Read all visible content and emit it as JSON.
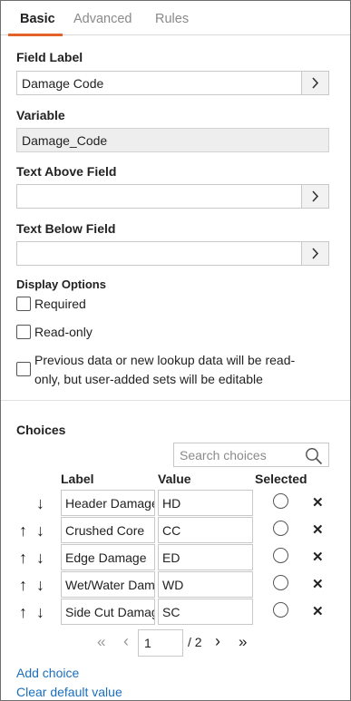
{
  "tabs": {
    "basic": "Basic",
    "advanced": "Advanced",
    "rules": "Rules"
  },
  "field_label": {
    "label": "Field Label",
    "value": "Damage Code"
  },
  "variable": {
    "label": "Variable",
    "value": "Damage_Code"
  },
  "text_above": {
    "label": "Text Above Field",
    "value": ""
  },
  "text_below": {
    "label": "Text Below Field",
    "value": ""
  },
  "display_options": {
    "label": "Display Options",
    "required": "Required",
    "readonly": "Read-only",
    "previous_line1": "Previous data or new lookup data will be read-",
    "previous_line2": "only, but user-added sets will be editable"
  },
  "choices": {
    "title": "Choices",
    "search_placeholder": "Search choices",
    "col_label": "Label",
    "col_value": "Value",
    "col_selected": "Selected",
    "rows": [
      {
        "label": "Header Damage",
        "value": "HD"
      },
      {
        "label": "Crushed Core",
        "value": "CC"
      },
      {
        "label": "Edge Damage",
        "value": "ED"
      },
      {
        "label": "Wet/Water Damage",
        "value": "WD"
      },
      {
        "label": "Side Cut Damage",
        "value": "SC"
      }
    ],
    "up_arrow": "↑",
    "down_arrow": "↓",
    "delete_glyph": "✕"
  },
  "pagination": {
    "first": "«",
    "prev": "‹",
    "page": "1",
    "total": "/ 2",
    "next": "›",
    "last": "»"
  },
  "links": {
    "add_choice": "Add choice",
    "clear_default": "Clear default value"
  }
}
